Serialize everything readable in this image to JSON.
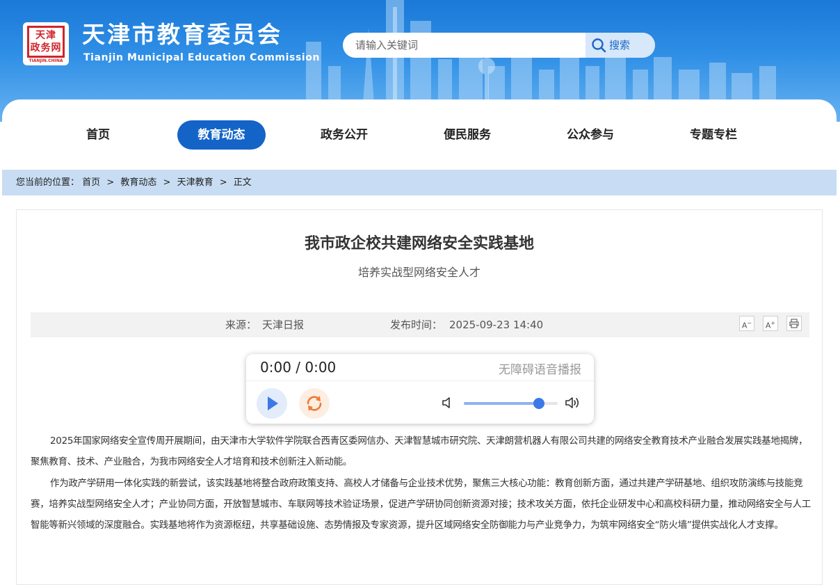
{
  "colors": {
    "header_blue": "#1b78d8",
    "nav_active": "#1464c8",
    "breadcrumb_bg": "#c8ddf3",
    "seal_red": "#d1242a"
  },
  "logo": {
    "seal_text": [
      "天津",
      "政务网"
    ],
    "sub": "TIANJIN.CHINA"
  },
  "header": {
    "title": "天津市教育委员会",
    "subtitle": "Tianjin Municipal Education Commission",
    "search": {
      "placeholder": "请输入关键词",
      "button_label": "搜索",
      "icon": "search-icon"
    }
  },
  "nav": {
    "items": [
      {
        "label": "首页",
        "active": false
      },
      {
        "label": "教育动态",
        "active": true
      },
      {
        "label": "政务公开",
        "active": false
      },
      {
        "label": "便民服务",
        "active": false
      },
      {
        "label": "公众参与",
        "active": false
      },
      {
        "label": "专题专栏",
        "active": false
      }
    ]
  },
  "breadcrumb": {
    "prefix": "您当前的位置：",
    "items": [
      "首页",
      "教育动态",
      "天津教育",
      "正文"
    ],
    "separator": ">"
  },
  "article": {
    "title": "我市政企校共建网络安全实践基地",
    "subtitle": "培养实战型网络安全人才",
    "meta": {
      "source_label": "来源：",
      "source": "天津日报",
      "date_label": "发布时间：",
      "date": "2025-09-23 14:40"
    },
    "tools": {
      "font_smaller": "A",
      "font_larger": "A",
      "print_icon": "print-icon"
    },
    "audio": {
      "time": "0:00 / 0:00",
      "label": "无障碍语音播报",
      "volume_level": 0.8,
      "icons": [
        "play-icon",
        "loop-icon",
        "volume-mute-icon",
        "volume-max-icon"
      ]
    },
    "paragraphs": [
      "2025年国家网络安全宣传周开展期间，由天津市大学软件学院联合西青区委网信办、天津智慧城市研究院、天津朗营机器人有限公司共建的网络安全教育技术产业融合发展实践基地揭牌，聚焦教育、技术、产业融合，为我市网络安全人才培育和技术创新注入新动能。",
      "作为政产学研用一体化实践的新尝试，该实践基地将整合政府政策支持、高校人才储备与企业技术优势，聚焦三大核心功能：教育创新方面，通过共建产学研基地、组织攻防演练与技能竞赛，培养实战型网络安全人才；产业协同方面，开放智慧城市、车联网等技术验证场景，促进产学研协同创新资源对接；技术攻关方面，依托企业研发中心和高校科研力量，推动网络安全与人工智能等新兴领域的深度融合。实践基地将作为资源枢纽，共享基础设施、态势情报及专家资源，提升区域网络安全防御能力与产业竞争力，为筑牢网络安全“防火墙”提供实战化人才支撑。"
    ]
  }
}
